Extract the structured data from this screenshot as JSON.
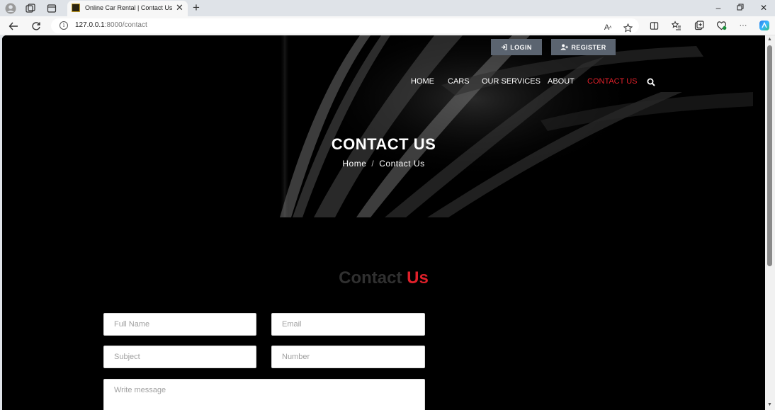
{
  "browser": {
    "tab_title": "Online Car Rental | Contact Us",
    "url_host": "127.0.0.1",
    "url_path": ":8000/contact",
    "read_aloud_label": "A̅"
  },
  "header": {
    "login_label": "LOGIN",
    "register_label": "REGISTER",
    "nav": [
      {
        "label": "HOME"
      },
      {
        "label": "CARS"
      },
      {
        "label": "OUR SERVICES"
      },
      {
        "label": "ABOUT"
      },
      {
        "label": "CONTACT US"
      }
    ],
    "active_nav": "CONTACT US"
  },
  "hero": {
    "title": "CONTACT US",
    "breadcrumb_home": "Home",
    "breadcrumb_sep": "/",
    "breadcrumb_current": "Contact Us"
  },
  "contact": {
    "heading_part1": "Contact",
    "heading_part2": "Us",
    "fields": {
      "name_placeholder": "Full Name",
      "email_placeholder": "Email",
      "subject_placeholder": "Subject",
      "number_placeholder": "Number",
      "message_placeholder": "Write message"
    }
  },
  "colors": {
    "accent": "#e0202a",
    "hero_bg": "#000000",
    "button_bg": "#5b6470"
  }
}
